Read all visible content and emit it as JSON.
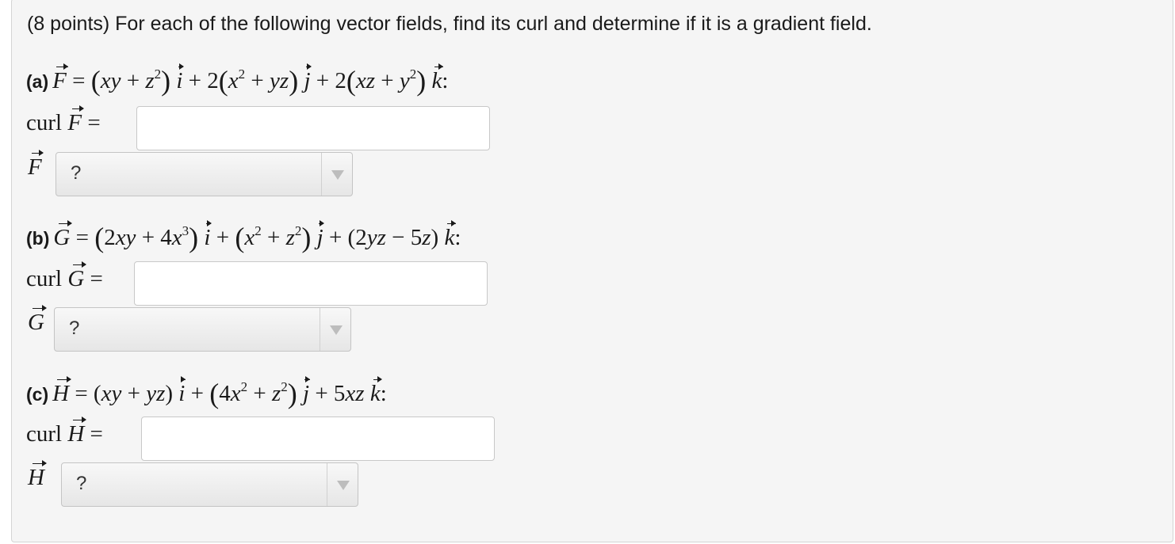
{
  "intro": "(8 points) For each of the following vector fields, find its curl and determine if it is a gradient field.",
  "parts": [
    {
      "tag": "(a)",
      "field": "F",
      "curl_label": "curl",
      "input_value": "",
      "dropdown_selected": "?"
    },
    {
      "tag": "(b)",
      "field": "G",
      "curl_label": "curl",
      "input_value": "",
      "dropdown_selected": "?"
    },
    {
      "tag": "(c)",
      "field": "H",
      "curl_label": "curl",
      "input_value": "",
      "dropdown_selected": "?"
    }
  ]
}
